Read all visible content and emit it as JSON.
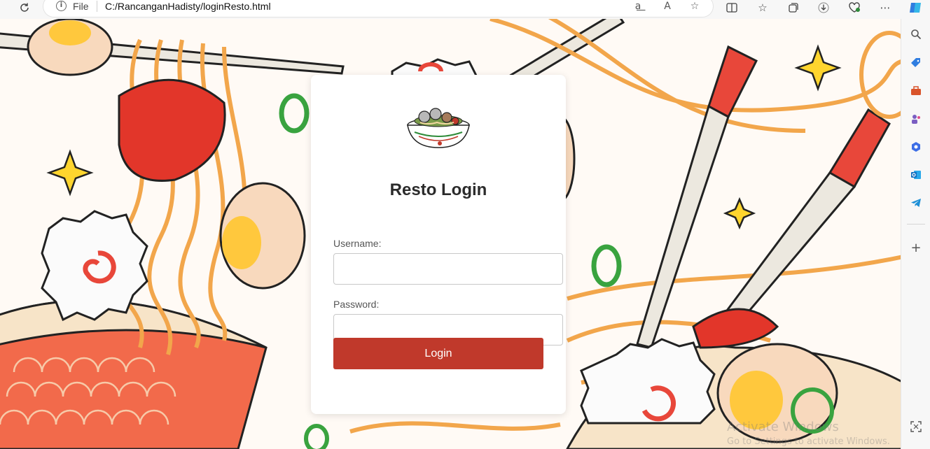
{
  "browser": {
    "addressbar": {
      "scheme_label": "File",
      "url": "C:/RancanganHadisty/loginResto.html"
    },
    "toolbar_icons": [
      "refresh-icon",
      "info-icon",
      "read-aloud-translate-icon",
      "reader-view-icon",
      "favorite-star-icon",
      "split-screen-icon",
      "favorites-icon",
      "collections-icon",
      "downloads-icon",
      "browser-essentials-icon",
      "more-icon",
      "copilot-icon"
    ],
    "sidebar_icons": [
      "search-icon",
      "shopping-tag-icon",
      "tools-icon",
      "games-icon",
      "microsoft365-icon",
      "outlook-icon",
      "telegram-icon",
      "add-icon",
      "screenshot-icon"
    ]
  },
  "login": {
    "title": "Resto Login",
    "username_label": "Username:",
    "username_value": "",
    "password_label": "Password:",
    "password_value": "",
    "button_label": "Login",
    "accent_color": "#c0392b"
  },
  "watermark": {
    "line1": "Activate Windows",
    "line2": "Go to Settings to activate Windows."
  }
}
